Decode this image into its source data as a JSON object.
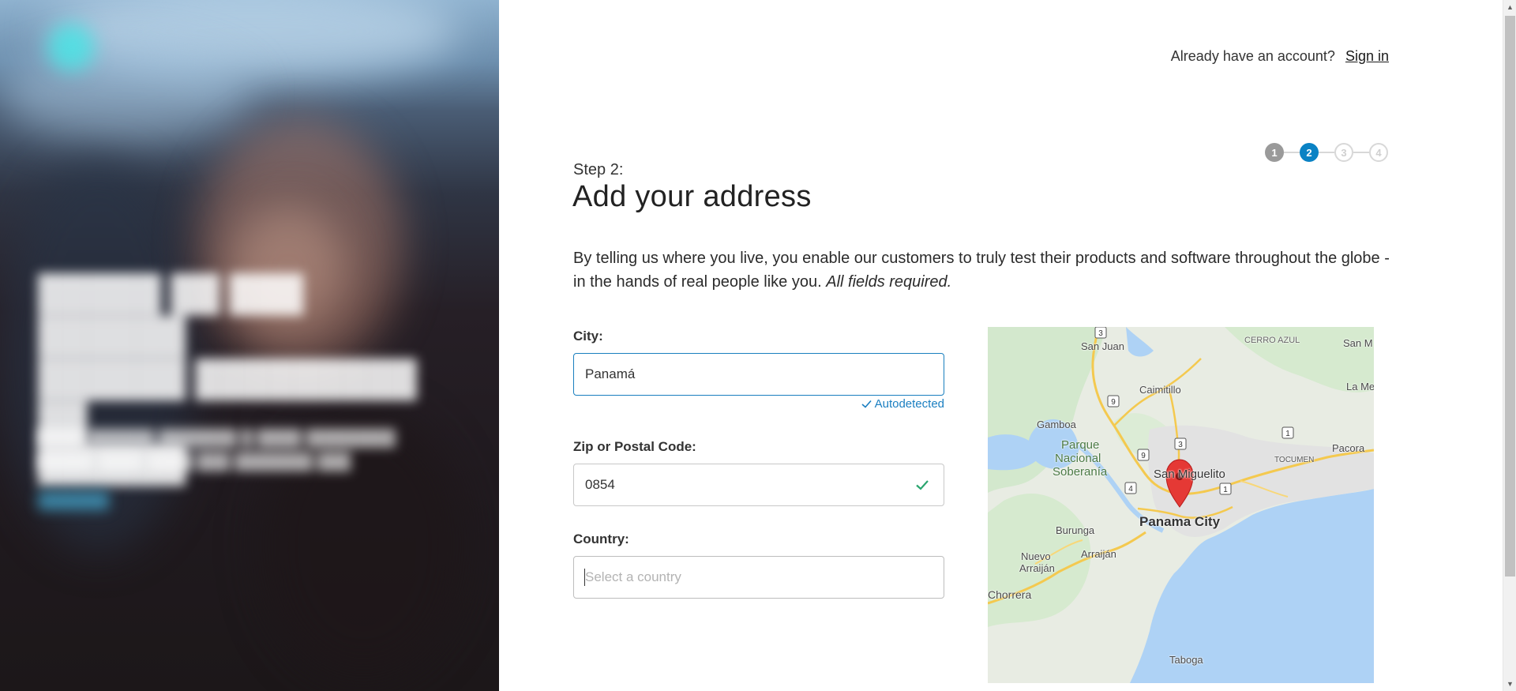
{
  "header": {
    "prompt": "Already have an account?",
    "signin_label": "Sign in"
  },
  "stepper": {
    "steps": [
      {
        "number": "1",
        "state": "done"
      },
      {
        "number": "2",
        "state": "active"
      },
      {
        "number": "3",
        "state": "todo"
      },
      {
        "number": "4",
        "state": "todo"
      }
    ]
  },
  "page": {
    "step_label": "Step 2:",
    "title": "Add your address",
    "intro_text": "By telling us where you live, you enable our customers to truly test their products and software throughout the globe - in the hands of real people like you.",
    "intro_emphasis": "All fields required."
  },
  "form": {
    "city": {
      "label": "City:",
      "value": "Panamá",
      "hint": "Autodetected"
    },
    "zip": {
      "label": "Zip or Postal Code:",
      "value": "0854"
    },
    "country": {
      "label": "Country:",
      "value": "",
      "placeholder": "Select a country"
    }
  },
  "map": {
    "places": {
      "san_juan": "San Juan",
      "cerro_azul": "CERRO AZUL",
      "san_m": "San M",
      "caimitillo": "Caimitillo",
      "la_me": "La Me",
      "gamboa": "Gamboa",
      "parque": "Parque",
      "nacional": "Nacional",
      "soberania": "Soberanía",
      "pacora": "Pacora",
      "tocumen": "TOCUMEN",
      "san_miguelito": "San Miguelito",
      "panama_city": "Panama City",
      "burunga": "Burunga",
      "nuevo": "Nuevo",
      "arraijan_low": "Arraiján",
      "arraijan": "Arraiján",
      "chorrera": "Chorrera",
      "taboga": "Taboga"
    },
    "route_badges": [
      "3",
      "9",
      "9",
      "3",
      "4",
      "1",
      "1"
    ]
  },
  "colors": {
    "accent": "#0a82c4",
    "focus_border": "#1a7fbf",
    "success": "#2aa56f",
    "pin": "#e53935",
    "water": "#aed2f5",
    "land": "#e9ede4"
  },
  "icons": {
    "valid": "check-icon",
    "pin": "map-pin-icon"
  }
}
